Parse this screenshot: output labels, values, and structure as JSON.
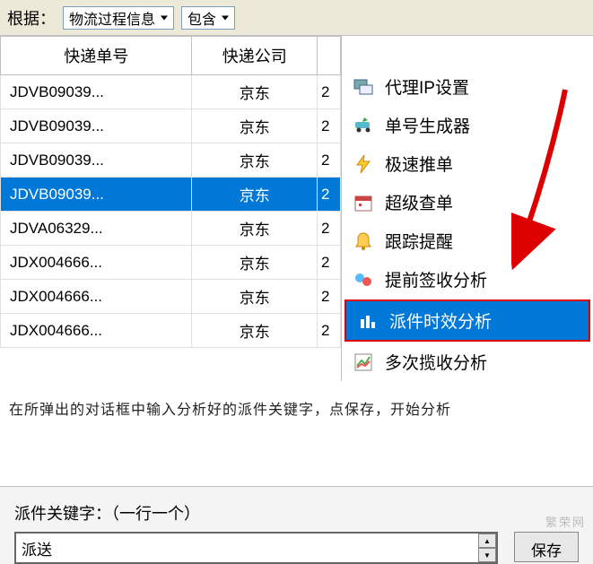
{
  "topbar": {
    "label": "根据：",
    "filter_field": "物流过程信息",
    "filter_op": "包含"
  },
  "table": {
    "headers": [
      "快递单号",
      "快递公司"
    ],
    "rows": [
      {
        "id": "JDVB09039...",
        "company": "京东",
        "third": "2",
        "selected": false
      },
      {
        "id": "JDVB09039...",
        "company": "京东",
        "third": "2",
        "selected": false
      },
      {
        "id": "JDVB09039...",
        "company": "京东",
        "third": "2",
        "selected": false
      },
      {
        "id": "JDVB09039...",
        "company": "京东",
        "third": "2",
        "selected": true
      },
      {
        "id": "JDVA06329...",
        "company": "京东",
        "third": "2",
        "selected": false
      },
      {
        "id": "JDX004666...",
        "company": "京东",
        "third": "2",
        "selected": false
      },
      {
        "id": "JDX004666...",
        "company": "京东",
        "third": "2",
        "selected": false
      },
      {
        "id": "JDX004666...",
        "company": "京东",
        "third": "2",
        "selected": false
      }
    ]
  },
  "menu": {
    "items": [
      {
        "label": "代理IP设置",
        "icon": "proxy-ip-icon",
        "selected": false
      },
      {
        "label": "单号生成器",
        "icon": "car-icon",
        "selected": false
      },
      {
        "label": "极速推单",
        "icon": "lightning-icon",
        "selected": false
      },
      {
        "label": "超级查单",
        "icon": "calendar-icon",
        "selected": false
      },
      {
        "label": "跟踪提醒",
        "icon": "bell-icon",
        "selected": false
      },
      {
        "label": "提前签收分析",
        "icon": "bubbles-icon",
        "selected": false
      },
      {
        "label": "派件时效分析",
        "icon": "bars-icon",
        "selected": true
      },
      {
        "label": "多次揽收分析",
        "icon": "chart-icon",
        "selected": false
      }
    ]
  },
  "instruction": "在所弹出的对话框中输入分析好的派件关键字，点保存，开始分析",
  "bottom": {
    "keyword_label": "派件关键字：（一行一个）",
    "keyword_value": "派送",
    "save_label": "保存"
  },
  "watermark": "繁荣网"
}
